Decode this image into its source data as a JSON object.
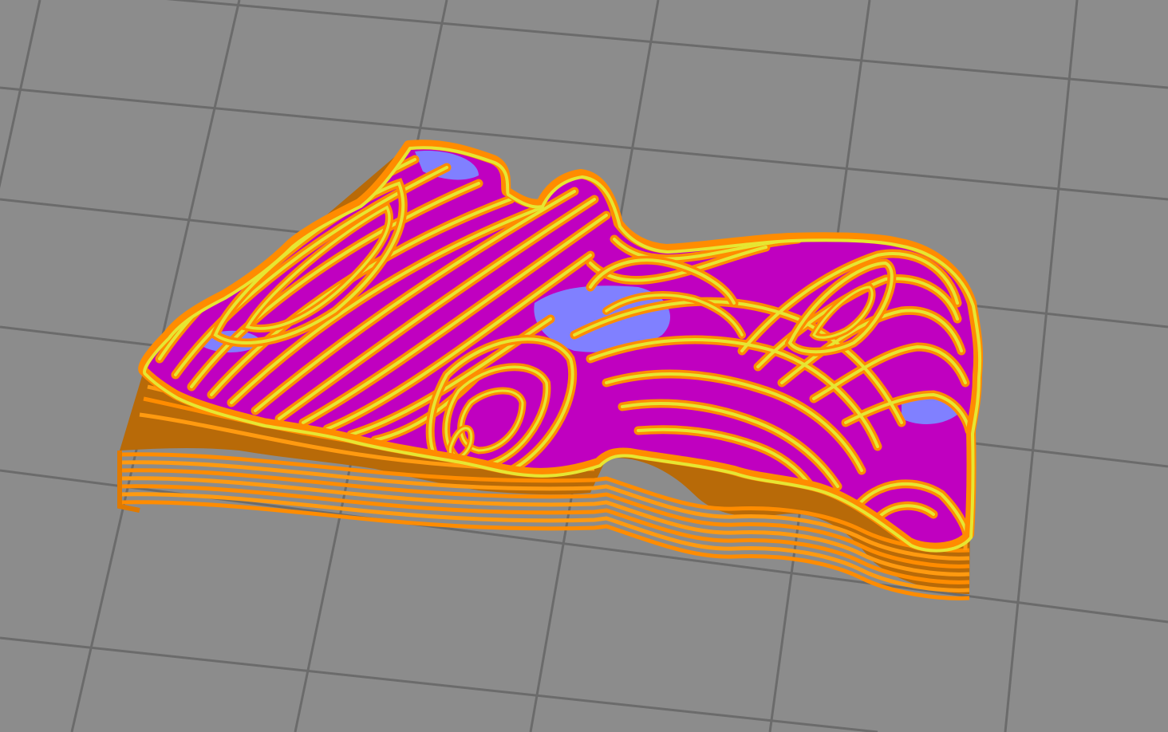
{
  "scene": {
    "background_color": "#8c8c8c",
    "grid_color": "#6c6c6c",
    "colors": {
      "external_perimeter": "#ff8c00",
      "perimeter": "#e6e632",
      "solid_infill": "#c000c0",
      "top_solid_infill": "#8080ff",
      "wall_side_dark": "#c87000"
    },
    "layer_count_visible": 10
  }
}
